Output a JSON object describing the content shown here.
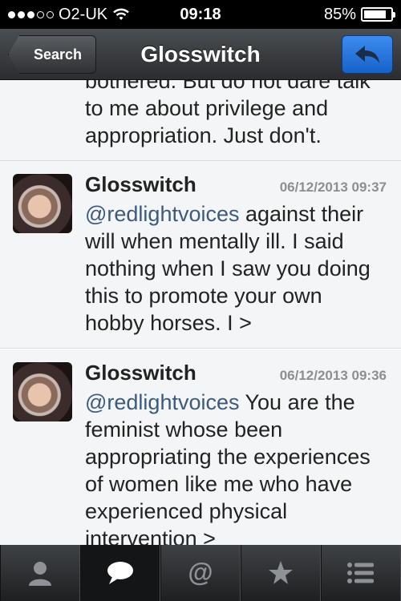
{
  "status_bar": {
    "carrier": "O2-UK",
    "time": "09:18",
    "battery": "85%",
    "battery_level": 0.85
  },
  "nav": {
    "back_label": "Search",
    "title": "Glosswitch",
    "reply_icon": "reply-icon"
  },
  "tweets": [
    {
      "text": "bothered. But do not dare talk to me about privilege and appropriation. Just don't."
    },
    {
      "author": "Glosswitch",
      "timestamp": "06/12/2013 09:37",
      "mention": "@redlightvoices",
      "text": " against their will when mentally ill. I said nothing when I saw you doing this to promote your own hobby horses. I >"
    },
    {
      "author": "Glosswitch",
      "timestamp": "06/12/2013 09:36",
      "mention": "@redlightvoices",
      "text": " You are the feminist whose been appropriating the experiences of women like me who have experienced physical intervention >"
    }
  ],
  "tabs": [
    {
      "icon": "person-icon",
      "active": false
    },
    {
      "icon": "speech-bubble-icon",
      "active": true
    },
    {
      "icon": "at-icon",
      "active": false
    },
    {
      "icon": "star-icon",
      "active": false
    },
    {
      "icon": "list-icon",
      "active": false
    }
  ]
}
